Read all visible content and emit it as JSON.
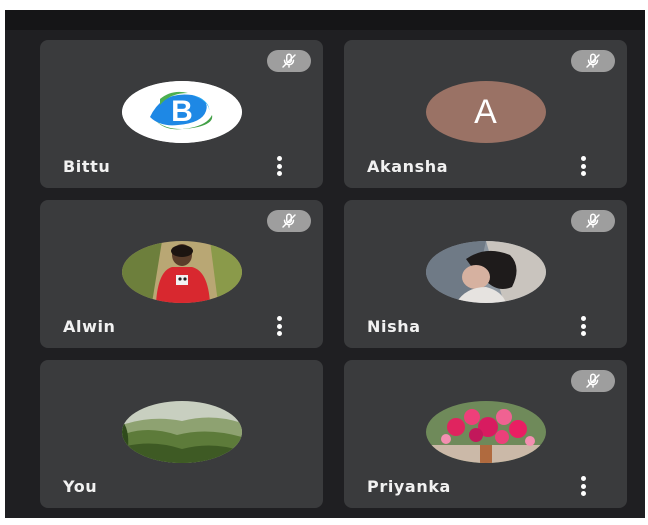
{
  "participants": [
    {
      "name": "Bittu",
      "muted": true,
      "avatar": "logo-b",
      "menu": true
    },
    {
      "name": "Akansha",
      "muted": true,
      "avatar": "letter",
      "initial": "A",
      "avatar_color": "#9a7265",
      "menu": true
    },
    {
      "name": "Alwin",
      "muted": true,
      "avatar": "photo-person-red-shirt",
      "menu": true
    },
    {
      "name": "Nisha",
      "muted": true,
      "avatar": "photo-person-face",
      "menu": true
    },
    {
      "name": "You",
      "muted": false,
      "avatar": "photo-green-hills",
      "menu": false
    },
    {
      "name": "Priyanka",
      "muted": true,
      "avatar": "photo-pink-flowers",
      "menu": true
    }
  ],
  "icons": {
    "mute": "microphone-off-icon",
    "menu": "more-vertical-icon"
  },
  "colors": {
    "background": "#1f1f22",
    "tile": "#3a3b3d",
    "mute_badge": "#9e9e9e",
    "text": "#f1f1f1"
  }
}
